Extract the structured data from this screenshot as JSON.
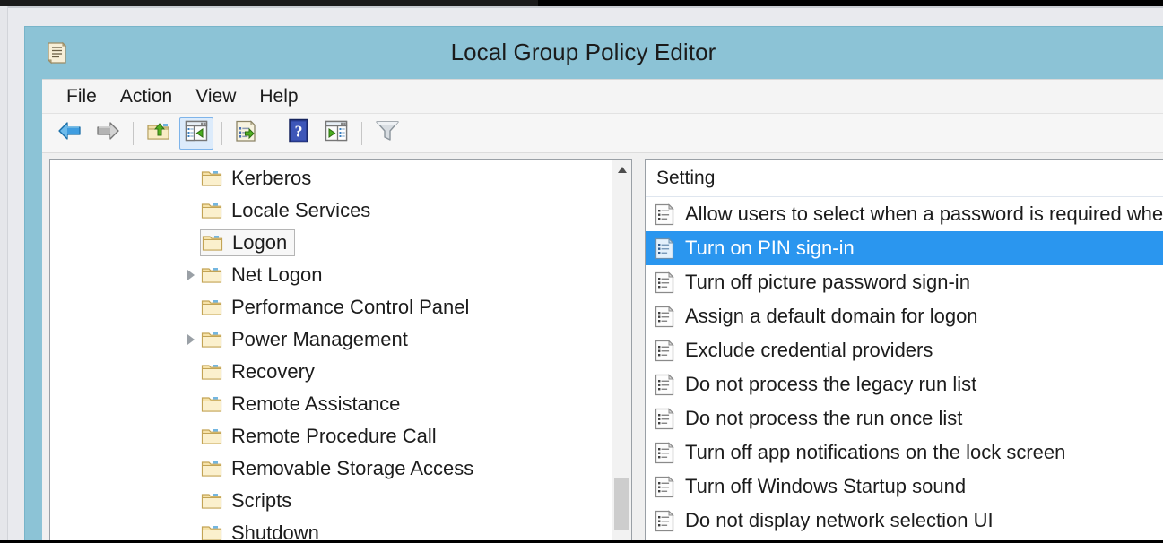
{
  "window": {
    "title": "Local Group Policy Editor",
    "app_icon": "policy-document-icon",
    "titlebar_color": "#8cc3d6"
  },
  "menubar": {
    "items": [
      {
        "label": "File",
        "name": "menu-file"
      },
      {
        "label": "Action",
        "name": "menu-action"
      },
      {
        "label": "View",
        "name": "menu-view"
      },
      {
        "label": "Help",
        "name": "menu-help"
      }
    ]
  },
  "toolbar": {
    "buttons": [
      {
        "icon": "back-arrow-icon",
        "name": "toolbar-back",
        "active": false
      },
      {
        "icon": "forward-arrow-icon",
        "name": "toolbar-forward",
        "active": false
      },
      {
        "icon": "up-one-level-folder-icon",
        "name": "toolbar-up-level",
        "active": false
      },
      {
        "icon": "show-hide-console-tree-icon",
        "name": "toolbar-show-console-tree",
        "active": true
      },
      {
        "icon": "export-list-icon",
        "name": "toolbar-export-list",
        "active": false
      },
      {
        "icon": "help-question-icon",
        "name": "toolbar-help",
        "active": false
      },
      {
        "icon": "show-action-pane-icon",
        "name": "toolbar-show-action-pane",
        "active": false
      },
      {
        "icon": "filter-funnel-icon",
        "name": "toolbar-filter",
        "active": false
      }
    ]
  },
  "tree": {
    "scroll": {
      "up_arrow": "chevron-up-icon",
      "thumb_position": "bottom"
    },
    "items": [
      {
        "label": "Kerberos",
        "expandable": false,
        "selected": false
      },
      {
        "label": "Locale Services",
        "expandable": false,
        "selected": false
      },
      {
        "label": "Logon",
        "expandable": false,
        "selected": true
      },
      {
        "label": "Net Logon",
        "expandable": true,
        "selected": false
      },
      {
        "label": "Performance Control Panel",
        "expandable": false,
        "selected": false
      },
      {
        "label": "Power Management",
        "expandable": true,
        "selected": false
      },
      {
        "label": "Recovery",
        "expandable": false,
        "selected": false
      },
      {
        "label": "Remote Assistance",
        "expandable": false,
        "selected": false
      },
      {
        "label": "Remote Procedure Call",
        "expandable": false,
        "selected": false
      },
      {
        "label": "Removable Storage Access",
        "expandable": false,
        "selected": false
      },
      {
        "label": "Scripts",
        "expandable": false,
        "selected": false
      },
      {
        "label": "Shutdown",
        "expandable": false,
        "selected": false
      }
    ]
  },
  "list": {
    "columns": [
      {
        "label": "Setting",
        "name": "column-setting"
      }
    ],
    "selection_color": "#2a96ef",
    "rows": [
      {
        "label": "Allow users to select when a password is required when resuming from connected standby",
        "selected": false
      },
      {
        "label": "Turn on PIN sign-in",
        "selected": true
      },
      {
        "label": "Turn off picture password sign-in",
        "selected": false
      },
      {
        "label": "Assign a default domain for logon",
        "selected": false
      },
      {
        "label": "Exclude credential providers",
        "selected": false
      },
      {
        "label": "Do not process the legacy run list",
        "selected": false
      },
      {
        "label": "Do not process the run once list",
        "selected": false
      },
      {
        "label": "Turn off app notifications on the lock screen",
        "selected": false
      },
      {
        "label": "Turn off Windows Startup sound",
        "selected": false
      },
      {
        "label": "Do not display network selection UI",
        "selected": false
      }
    ]
  }
}
